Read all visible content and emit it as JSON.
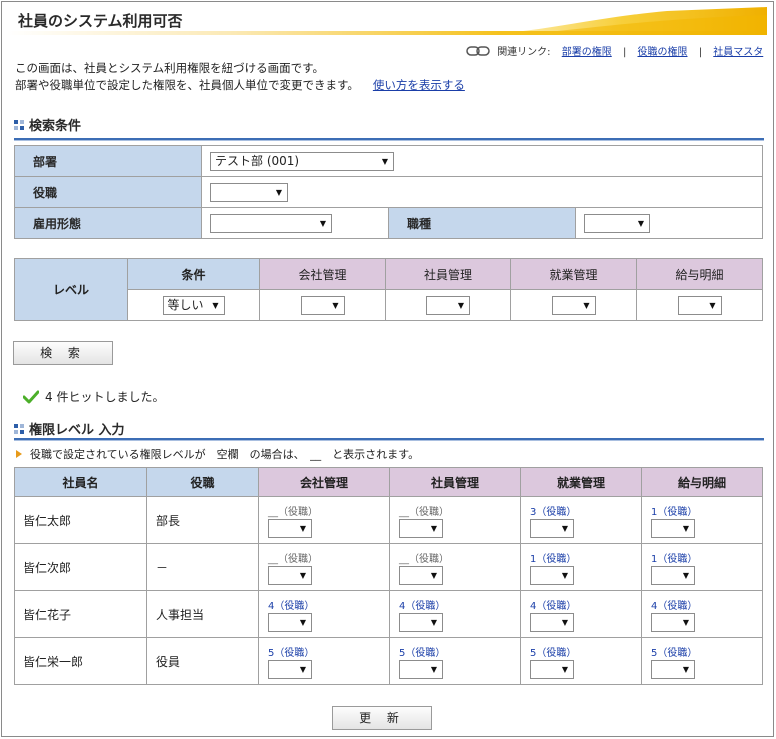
{
  "title": "社員のシステム利用可否",
  "related": {
    "label": "関連リンク:",
    "links": [
      "部署の権限",
      "役職の権限",
      "社員マスタ"
    ]
  },
  "description": {
    "line1": "この画面は、社員とシステム利用権限を紐づける画面です。",
    "line2": "部署や役職単位で設定した権限を、社員個人単位で変更できます。",
    "howto_link": "使い方を表示する"
  },
  "search_section": {
    "heading": "検索条件",
    "dept_label": "部署",
    "dept_value": "テスト部 (001)",
    "position_label": "役職",
    "position_value": "",
    "employment_label": "雇用形態",
    "employment_value": "",
    "jobtype_label": "職種",
    "jobtype_value": ""
  },
  "level_filter": {
    "row_label": "レベル",
    "condition_label": "条件",
    "condition_value": "等しい",
    "columns": [
      "会社管理",
      "社員管理",
      "就業管理",
      "給与明細"
    ]
  },
  "search_button": "検 索",
  "hit_message": "4 件ヒットしました。",
  "input_section": {
    "heading": "権限レベル 入力",
    "note": "役職で設定されている権限レベルが　空欄　の場合は、　__　と表示されます。"
  },
  "results": {
    "headers": [
      "社員名",
      "役職",
      "会社管理",
      "社員管理",
      "就業管理",
      "給与明細"
    ],
    "rows": [
      {
        "name": "皆仁太郎",
        "position": "部長",
        "levels": [
          "__（役職）",
          "__（役職）",
          "3（役職）",
          "1（役職）"
        ]
      },
      {
        "name": "皆仁次郎",
        "position": "－",
        "levels": [
          "__（役職）",
          "__（役職）",
          "1（役職）",
          "1（役職）"
        ]
      },
      {
        "name": "皆仁花子",
        "position": "人事担当",
        "levels": [
          "4（役職）",
          "4（役職）",
          "4（役職）",
          "4（役職）"
        ]
      },
      {
        "name": "皆仁栄一郎",
        "position": "役員",
        "levels": [
          "5（役職）",
          "5（役職）",
          "5（役職）",
          "5（役職）"
        ]
      }
    ]
  },
  "update_button": "更 新",
  "colors": {
    "label_bg": "#c5d7ec",
    "perm_header_bg": "#dcc8dd",
    "section_rule": "#3c6db5",
    "link": "#1a3ea8",
    "title_accent": "#f5c21d"
  },
  "icons": [
    "chain-link-icon",
    "section-square-icon",
    "check-icon",
    "triangle-bullet-icon",
    "dropdown-arrow-icon"
  ]
}
